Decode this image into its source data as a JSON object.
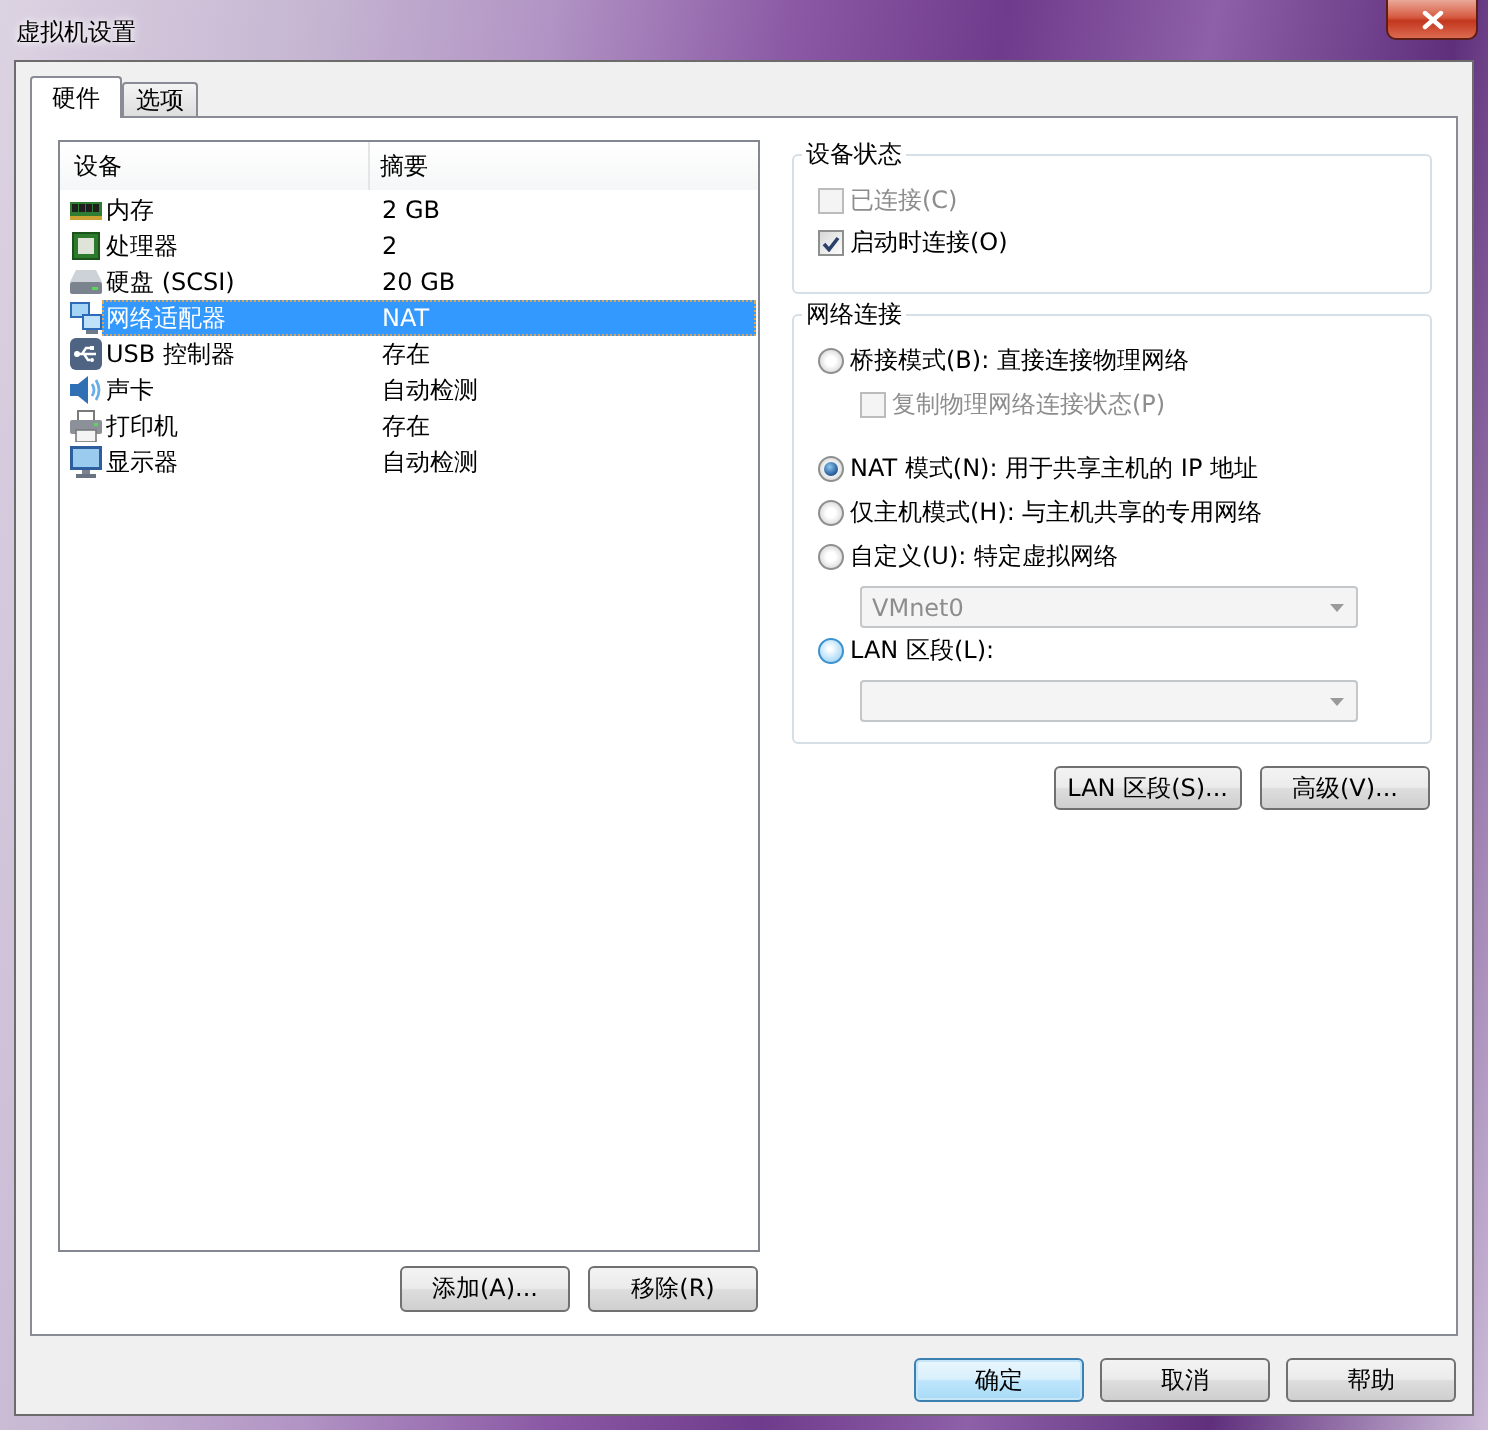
{
  "window": {
    "title": "虚拟机设置"
  },
  "tabs": [
    {
      "label": "硬件",
      "selected": true
    },
    {
      "label": "选项",
      "selected": false
    }
  ],
  "device_list": {
    "columns": [
      "设备",
      "摘要"
    ],
    "rows": [
      {
        "kind": "memory",
        "device": "内存",
        "summary": "2 GB",
        "selected": false
      },
      {
        "kind": "processor",
        "device": "处理器",
        "summary": "2",
        "selected": false
      },
      {
        "kind": "disk",
        "device": "硬盘 (SCSI)",
        "summary": "20 GB",
        "selected": false
      },
      {
        "kind": "network",
        "device": "网络适配器",
        "summary": "NAT",
        "selected": true
      },
      {
        "kind": "usb",
        "device": "USB 控制器",
        "summary": "存在",
        "selected": false
      },
      {
        "kind": "sound",
        "device": "声卡",
        "summary": "自动检测",
        "selected": false
      },
      {
        "kind": "printer",
        "device": "打印机",
        "summary": "存在",
        "selected": false
      },
      {
        "kind": "display",
        "device": "显示器",
        "summary": "自动检测",
        "selected": false
      }
    ]
  },
  "device_buttons": [
    "添加(A)...",
    "移除(R)"
  ],
  "device_status": {
    "title": "设备状态",
    "options": [
      {
        "label": "已连接(C)",
        "checked": false,
        "disabled": true
      },
      {
        "label": "启动时连接(O)",
        "checked": true,
        "disabled": false
      }
    ]
  },
  "network_connection": {
    "title": "网络连接",
    "items": [
      {
        "kind": "radio",
        "label": "桥接模式(B): 直接连接物理网络",
        "selected": false,
        "hovered": false
      },
      {
        "kind": "checkbox",
        "label": "复制物理网络连接状态(P)",
        "checked": false,
        "disabled": true
      },
      {
        "kind": "radio",
        "label": "NAT 模式(N): 用于共享主机的 IP 地址",
        "selected": true,
        "hovered": false
      },
      {
        "kind": "radio",
        "label": "仅主机模式(H): 与主机共享的专用网络",
        "selected": false,
        "hovered": false
      },
      {
        "kind": "radio",
        "label": "自定义(U): 特定虚拟网络",
        "selected": false,
        "hovered": false
      },
      {
        "kind": "dropdown",
        "value": "VMnet0",
        "disabled": true
      },
      {
        "kind": "radio",
        "label": "LAN 区段(L):",
        "selected": false,
        "hovered": true
      },
      {
        "kind": "dropdown",
        "disabled": true
      }
    ]
  },
  "network_buttons": [
    "LAN 区段(S)...",
    "高级(V)..."
  ],
  "dialog_buttons": [
    {
      "label": "确定",
      "default": true
    },
    {
      "label": "取消",
      "default": false
    },
    {
      "label": "帮助",
      "default": false
    }
  ]
}
